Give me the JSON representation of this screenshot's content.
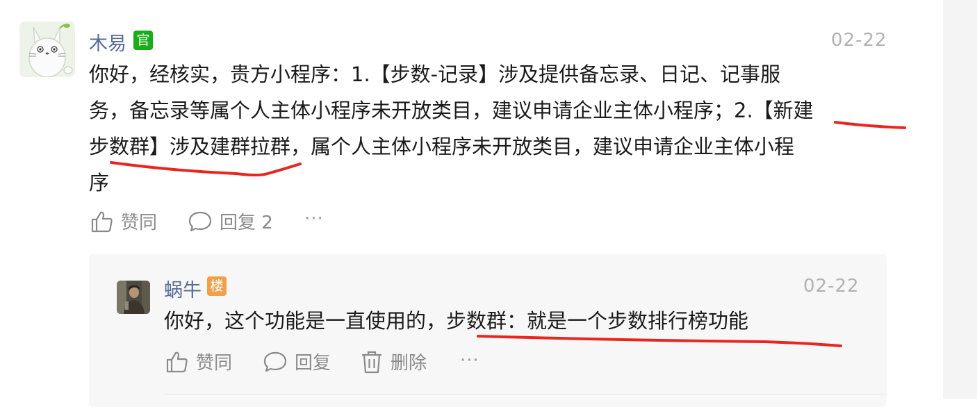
{
  "comment": {
    "author": "木易",
    "badge": "官",
    "date": "02-22",
    "text": "你好，经核实，贵方小程序：1.【步数-记录】涉及提供备忘录、日记、记事服务，备忘录等属个人主体小程序未开放类目，建议申请企业主体小程序；2.【新建步数群】涉及建群拉群，属个人主体小程序未开放类目，建议申请企业主体小程序",
    "lines": [
      "你好，经核实，贵方小程序：1.【步数-记录】涉及提供备忘录、日记、记事服",
      "务，备忘录等属个人主体小程序未开放类目，建议申请企业主体小程序；2.【新建",
      "步数群】涉及建群拉群，属个人主体小程序未开放类目，建议申请企业主体小程",
      "序"
    ],
    "actions": {
      "like": "赞同",
      "reply": "回复 2",
      "more": "···"
    }
  },
  "reply": {
    "author": "蜗牛",
    "badge": "楼",
    "date": "02-22",
    "text": "你好，这个功能是一直使用的，步数群：就是一个步数排行榜功能",
    "actions": {
      "like": "赞同",
      "reply": "回复",
      "delete": "删除",
      "more": "···"
    }
  },
  "colors": {
    "name": "#576b95",
    "official_badge": "#1aad19",
    "floor_badge": "#f0a04b",
    "annotation": "#e8261f"
  }
}
